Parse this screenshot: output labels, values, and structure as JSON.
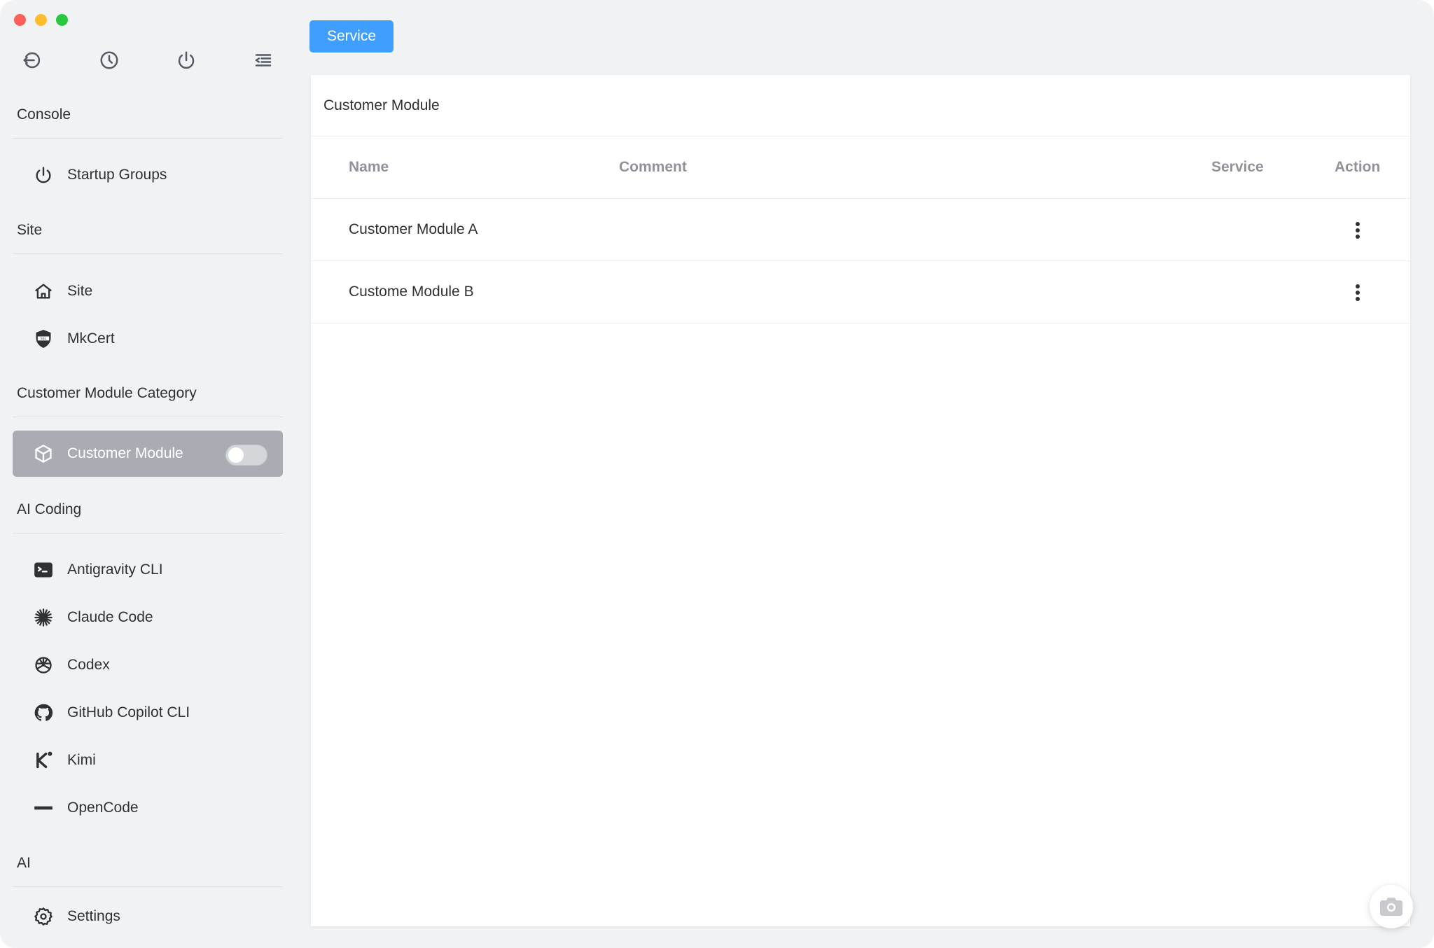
{
  "window": {
    "traffic_lights": [
      "close",
      "minimize",
      "zoom"
    ]
  },
  "toolbar": {
    "icons": [
      "back-icon",
      "history-icon",
      "power-icon",
      "menu-collapse-icon"
    ]
  },
  "sidebar": {
    "sections": [
      {
        "title": "Console",
        "items": [
          {
            "label": "Startup Groups",
            "icon": "power-icon"
          }
        ]
      },
      {
        "title": "Site",
        "items": [
          {
            "label": "Site",
            "icon": "home-icon"
          },
          {
            "label": "MkCert",
            "icon": "ssl-shield-icon"
          }
        ]
      },
      {
        "title": "Customer Module Category",
        "items": [
          {
            "label": "Customer Module",
            "icon": "cube-icon",
            "active": true,
            "toggle_on": false
          }
        ]
      },
      {
        "title": "AI Coding",
        "items": [
          {
            "label": "Antigravity CLI",
            "icon": "terminal-icon"
          },
          {
            "label": "Claude Code",
            "icon": "claude-icon"
          },
          {
            "label": "Codex",
            "icon": "openai-icon"
          },
          {
            "label": "GitHub Copilot CLI",
            "icon": "github-icon"
          },
          {
            "label": "Kimi",
            "icon": "kimi-icon"
          },
          {
            "label": "OpenCode",
            "icon": "opencode-icon"
          }
        ]
      },
      {
        "title": "AI",
        "items": [
          {
            "label": "Settings",
            "icon": "gear-icon"
          }
        ]
      }
    ]
  },
  "main": {
    "tab_button": "Service",
    "panel_title": "Customer Module",
    "table": {
      "columns": [
        "Name",
        "Comment",
        "Service",
        "Action"
      ],
      "rows": [
        {
          "name": "Customer Module A",
          "comment": "",
          "service": ""
        },
        {
          "name": "Custome Module B",
          "comment": "",
          "service": ""
        }
      ]
    }
  },
  "colors": {
    "accent": "#409eff",
    "active_item_bg": "#a9acb2",
    "window_bg": "#f1f2f4"
  }
}
